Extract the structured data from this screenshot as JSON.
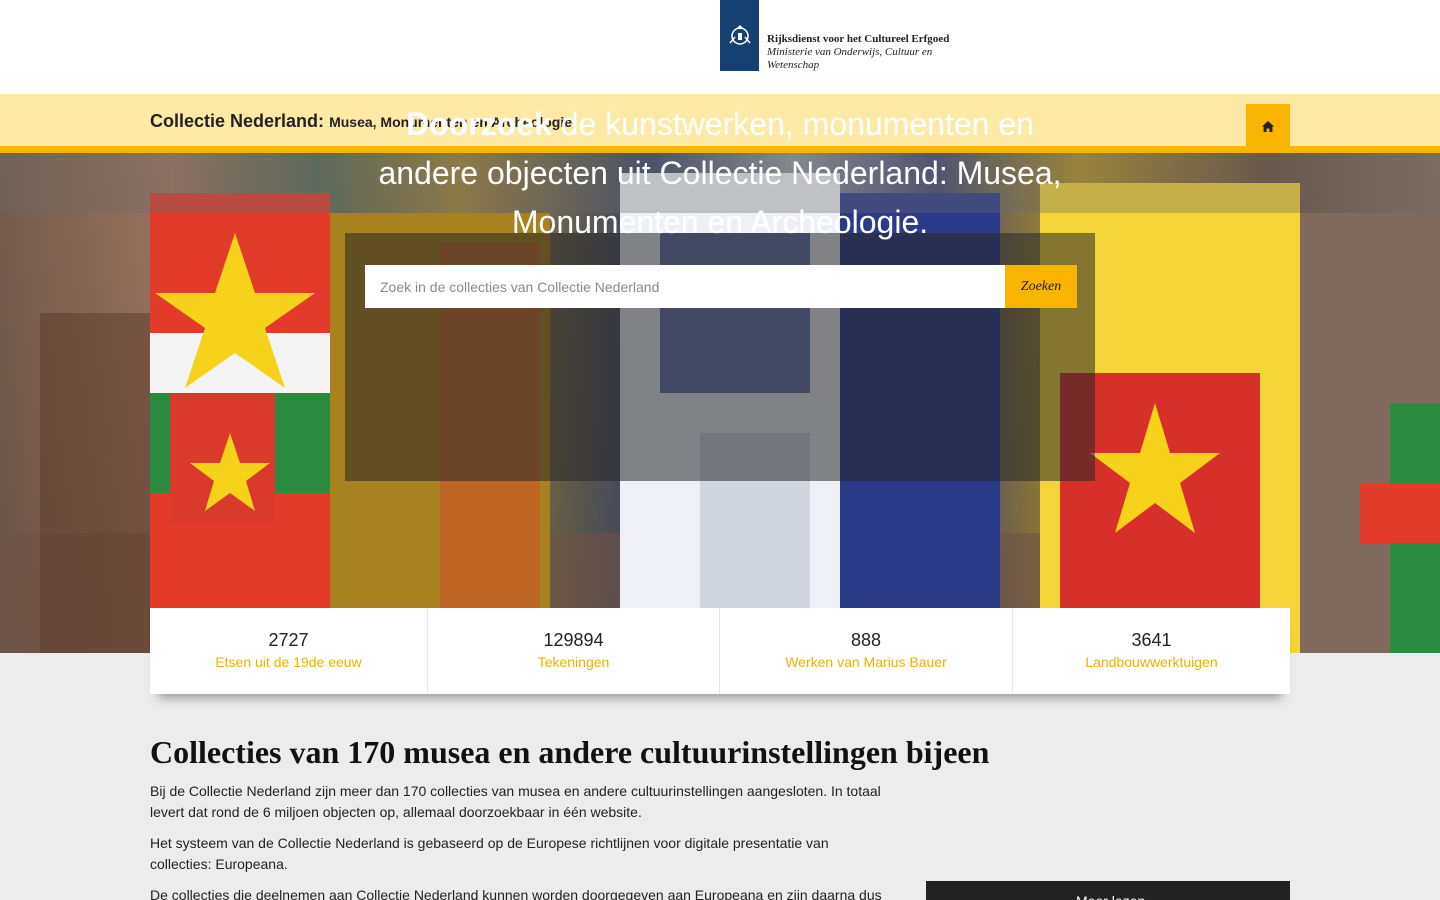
{
  "logo": {
    "line1": "Rijksdienst voor het Cultureel Erfgoed",
    "line2": "Ministerie van Onderwijs, Cultuur en",
    "line3": "Wetenschap",
    "emblem_icon": "crest-icon"
  },
  "header": {
    "title_main": "Collectie Nederland:",
    "title_sub": "Musea, Monumenten en Archeologie",
    "home_icon": "home-icon"
  },
  "hero": {
    "title_bold": "Doorzoek",
    "title_rest": "de kunstwerken, monumenten en andere objecten uit Collectie Nederland: Musea, Monumenten en Archeologie.",
    "search_placeholder": "Zoek in de collecties van Collectie Nederland",
    "search_value": "",
    "search_button": "Zoeken"
  },
  "stats": [
    {
      "number": "2727",
      "label": "Etsen uit de 19de eeuw"
    },
    {
      "number": "129894",
      "label": "Tekeningen"
    },
    {
      "number": "888",
      "label": "Werken van Marius Bauer"
    },
    {
      "number": "3641",
      "label": "Landbouwwerktuigen"
    }
  ],
  "content": {
    "heading": "Collecties van 170 musea en andere cultuurinstellingen bijeen",
    "p1": "Bij de Collectie Nederland zijn meer dan 170 collecties van musea en andere cultuurinstellingen aangesloten. In totaal levert dat rond de 6 miljoen objecten op, allemaal doorzoekbaar in één website.",
    "p2": "Het systeem van de Collectie Nederland is gebaseerd op de Europese richtlijnen voor digitale presentatie van collecties: Europeana.",
    "p3": "De collecties die deelnemen aan Collectie Nederland kunnen worden doorgegeven aan Europeana en zijn daarna dus ook op",
    "sidebar_label": "Meer lezen"
  },
  "colors": {
    "accent": "#f9b400",
    "header_bg": "#ffe9a7",
    "logo_blue": "#154273"
  }
}
